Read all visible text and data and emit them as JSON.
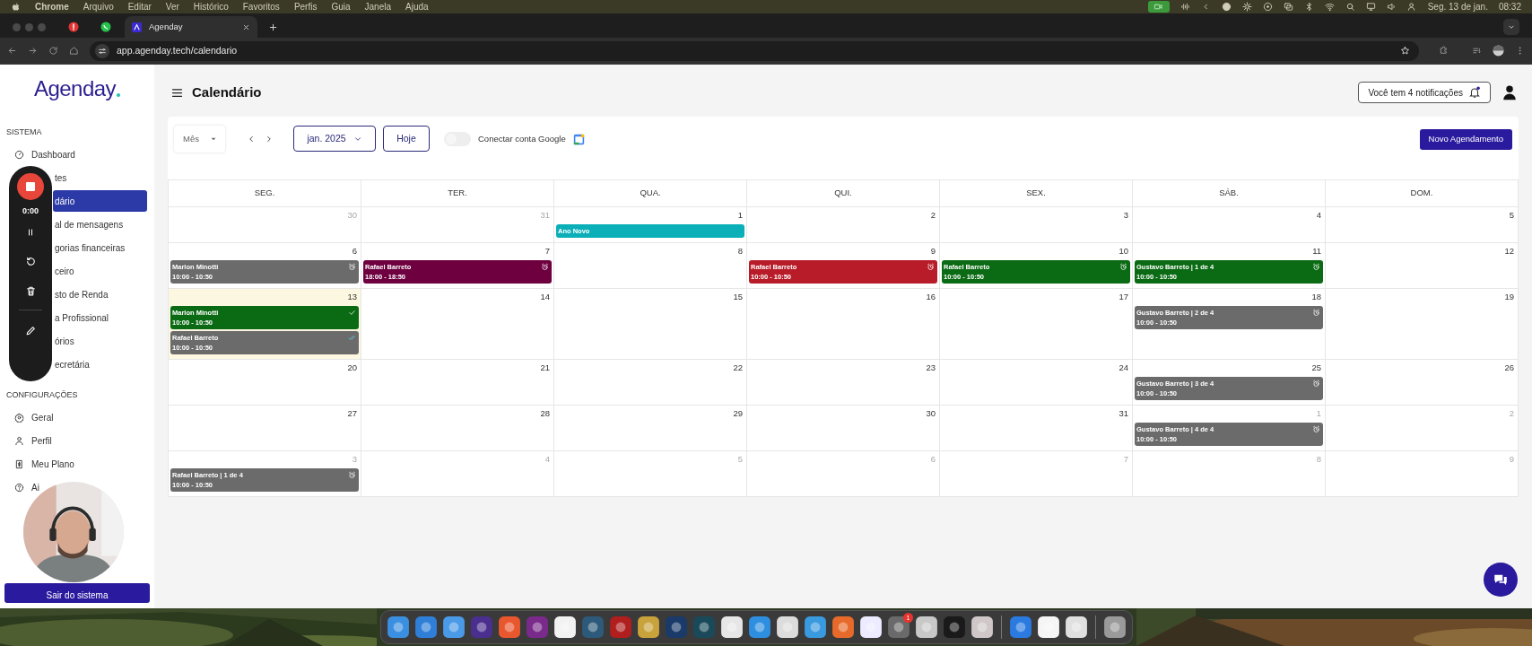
{
  "menubar": {
    "app": "Chrome",
    "menus": [
      "Arquivo",
      "Editar",
      "Ver",
      "Histórico",
      "Favoritos",
      "Perfis",
      "Guia",
      "Janela",
      "Ajuda"
    ],
    "date": "Seg. 13 de jan.",
    "time": "08:32"
  },
  "browser": {
    "tab_title": "Agenday",
    "url": "app.agenday.tech/calendario"
  },
  "sidebar": {
    "logo": "Agenday",
    "sections": [
      {
        "title": "SISTEMA",
        "items": [
          {
            "label": "Dashboard",
            "covered": false,
            "selected": false
          },
          {
            "label": "tes",
            "covered": true,
            "selected": false
          },
          {
            "label": "dário",
            "covered": true,
            "selected": true
          },
          {
            "label": "al de mensagens",
            "covered": true,
            "selected": false
          },
          {
            "label": "gorias financeiras",
            "covered": true,
            "selected": false
          },
          {
            "label": "ceiro",
            "covered": true,
            "selected": false
          },
          {
            "label": "sto de Renda",
            "covered": true,
            "selected": false
          },
          {
            "label": "a Profissional",
            "covered": true,
            "selected": false
          },
          {
            "label": "órios",
            "covered": true,
            "selected": false
          },
          {
            "label": "ecretária",
            "covered": true,
            "selected": false
          }
        ]
      },
      {
        "title": "CONFIGURAÇÕES",
        "items": [
          {
            "label": "Geral",
            "covered": false,
            "selected": false
          },
          {
            "label": "Perfil",
            "covered": false,
            "selected": false
          },
          {
            "label": "Meu Plano",
            "covered": false,
            "selected": false
          },
          {
            "label": "Ai",
            "covered": false,
            "selected": false
          }
        ]
      }
    ],
    "logout": "Sair do sistema"
  },
  "header": {
    "title": "Calendário",
    "notifications": "Você tem 4 notificações"
  },
  "toolbar": {
    "view": "Mês",
    "month": "jan. 2025",
    "today": "Hoje",
    "google_toggle": {
      "label": "Conectar conta Google",
      "on": false
    },
    "new_button": "Novo Agendamento"
  },
  "calendar": {
    "weekdays": [
      "SEG.",
      "TER.",
      "QUA.",
      "QUI.",
      "SEX.",
      "SÁB.",
      "DOM."
    ],
    "weeks": [
      {
        "days": [
          {
            "day": "30",
            "outside": true,
            "today": false
          },
          {
            "day": "31",
            "outside": true,
            "today": false
          },
          {
            "day": "1",
            "outside": false,
            "today": false,
            "events": [
              {
                "kind": "holiday",
                "title": "Ano Novo",
                "color": "#0aafb8"
              }
            ]
          },
          {
            "day": "2",
            "outside": false,
            "today": false
          },
          {
            "day": "3",
            "outside": false,
            "today": false
          },
          {
            "day": "4",
            "outside": false,
            "today": false
          },
          {
            "day": "5",
            "outside": false,
            "today": false
          }
        ]
      },
      {
        "days": [
          {
            "day": "6",
            "outside": false,
            "today": false,
            "events": [
              {
                "kind": "reminder",
                "title": "Marlon Minotti",
                "time": "10:00 - 10:50",
                "color": "#6b6b6b"
              }
            ]
          },
          {
            "day": "7",
            "outside": false,
            "today": false,
            "events": [
              {
                "kind": "reminder",
                "title": "Rafael Barreto",
                "time": "18:00 - 18:50",
                "color": "#6e0040"
              }
            ]
          },
          {
            "day": "8",
            "outside": false,
            "today": false
          },
          {
            "day": "9",
            "outside": false,
            "today": false,
            "events": [
              {
                "kind": "reminder",
                "title": "Rafael Barreto",
                "time": "10:00 - 10:50",
                "color": "#b81c28"
              }
            ]
          },
          {
            "day": "10",
            "outside": false,
            "today": false,
            "events": [
              {
                "kind": "reminder",
                "title": "Rafael Barreto",
                "time": "10:00 - 10:50",
                "color": "#0b6b14"
              }
            ]
          },
          {
            "day": "11",
            "outside": false,
            "today": false,
            "events": [
              {
                "kind": "reminder",
                "title": "Gustavo Barreto | 1 de 4",
                "time": "10:00 - 10:50",
                "color": "#0b6b14"
              }
            ]
          },
          {
            "day": "12",
            "outside": false,
            "today": false
          }
        ]
      },
      {
        "days": [
          {
            "day": "13",
            "outside": false,
            "today": true,
            "events": [
              {
                "kind": "confirmed",
                "title": "Marlon Minotti",
                "time": "10:00 - 10:50",
                "color": "#0b6b14"
              },
              {
                "kind": "completed",
                "title": "Rafael Barreto",
                "time": "10:00 - 10:50",
                "color": "#6b6b6b"
              }
            ]
          },
          {
            "day": "14",
            "outside": false,
            "today": false
          },
          {
            "day": "15",
            "outside": false,
            "today": false
          },
          {
            "day": "16",
            "outside": false,
            "today": false
          },
          {
            "day": "17",
            "outside": false,
            "today": false
          },
          {
            "day": "18",
            "outside": false,
            "today": false,
            "events": [
              {
                "kind": "reminder",
                "title": "Gustavo Barreto | 2 de 4",
                "time": "10:00 - 10:50",
                "color": "#6b6b6b"
              }
            ]
          },
          {
            "day": "19",
            "outside": false,
            "today": false
          }
        ]
      },
      {
        "days": [
          {
            "day": "20",
            "outside": false,
            "today": false
          },
          {
            "day": "21",
            "outside": false,
            "today": false
          },
          {
            "day": "22",
            "outside": false,
            "today": false
          },
          {
            "day": "23",
            "outside": false,
            "today": false
          },
          {
            "day": "24",
            "outside": false,
            "today": false
          },
          {
            "day": "25",
            "outside": false,
            "today": false,
            "events": [
              {
                "kind": "reminder",
                "title": "Gustavo Barreto | 3 de 4",
                "time": "10:00 - 10:50",
                "color": "#6b6b6b"
              }
            ]
          },
          {
            "day": "26",
            "outside": false,
            "today": false
          }
        ]
      },
      {
        "days": [
          {
            "day": "27",
            "outside": false,
            "today": false
          },
          {
            "day": "28",
            "outside": false,
            "today": false
          },
          {
            "day": "29",
            "outside": false,
            "today": false
          },
          {
            "day": "30",
            "outside": false,
            "today": false
          },
          {
            "day": "31",
            "outside": false,
            "today": false
          },
          {
            "day": "1",
            "outside": true,
            "today": false,
            "events": [
              {
                "kind": "reminder",
                "title": "Gustavo Barreto | 4 de 4",
                "time": "10:00 - 10:50",
                "color": "#6b6b6b"
              }
            ]
          },
          {
            "day": "2",
            "outside": true,
            "today": false
          }
        ]
      },
      {
        "days": [
          {
            "day": "3",
            "outside": true,
            "today": false,
            "events": [
              {
                "kind": "reminder",
                "title": "Rafael Barreto | 1 de 4",
                "time": "10:00 - 10:50",
                "color": "#6b6b6b"
              }
            ]
          },
          {
            "day": "4",
            "outside": true,
            "today": false
          },
          {
            "day": "5",
            "outside": true,
            "today": false
          },
          {
            "day": "6",
            "outside": true,
            "today": false
          },
          {
            "day": "7",
            "outside": true,
            "today": false
          },
          {
            "day": "8",
            "outside": true,
            "today": false
          },
          {
            "day": "9",
            "outside": true,
            "today": false
          }
        ]
      }
    ]
  },
  "recorder": {
    "time": "0:00"
  },
  "dock": [
    {
      "kind": "app",
      "color": "#3b8fe0"
    },
    {
      "kind": "app",
      "color": "#2f7fd8"
    },
    {
      "kind": "app",
      "color": "#4a9ae8"
    },
    {
      "kind": "app",
      "color": "#4b2f8f"
    },
    {
      "kind": "app",
      "color": "#e8572e"
    },
    {
      "kind": "app",
      "color": "#7a2a8a"
    },
    {
      "kind": "app",
      "color": "#f2f2f2"
    },
    {
      "kind": "app",
      "color": "#2d5a7a"
    },
    {
      "kind": "app",
      "color": "#b01e1e"
    },
    {
      "kind": "app",
      "color": "#c8a23a"
    },
    {
      "kind": "app",
      "color": "#1a3a6a"
    },
    {
      "kind": "app",
      "color": "#1a4a5a"
    },
    {
      "kind": "app",
      "color": "#e6e6e6"
    },
    {
      "kind": "app",
      "color": "#2e8fe0"
    },
    {
      "kind": "app",
      "color": "#dcdcdc"
    },
    {
      "kind": "app",
      "color": "#3a9ae0"
    },
    {
      "kind": "app",
      "color": "#e86a2a"
    },
    {
      "kind": "app",
      "color": "#ecebff"
    },
    {
      "kind": "app",
      "color": "#6a6a6a",
      "badge": "1"
    },
    {
      "kind": "app",
      "color": "#c8c8c8"
    },
    {
      "kind": "app",
      "color": "#1a1a1a"
    },
    {
      "kind": "app",
      "color": "#d0c8c8"
    },
    {
      "kind": "separator"
    },
    {
      "kind": "app",
      "color": "#2a7ae0"
    },
    {
      "kind": "app",
      "color": "#f5f5f5"
    },
    {
      "kind": "app",
      "color": "#e0e0e0"
    },
    {
      "kind": "separator"
    },
    {
      "kind": "app",
      "color": "#9a9a9a"
    }
  ]
}
